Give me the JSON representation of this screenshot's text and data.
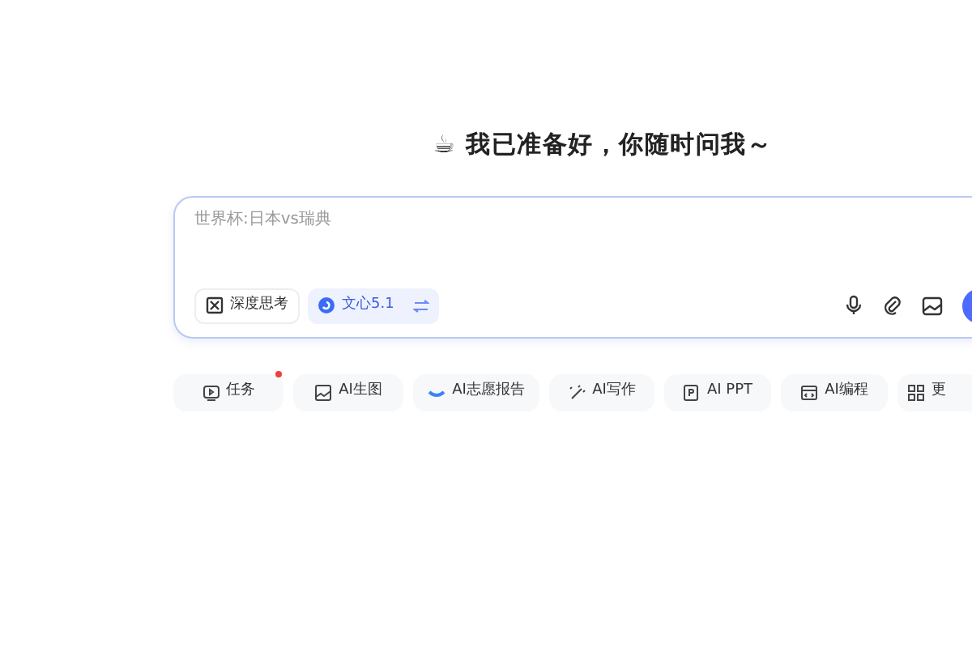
{
  "heading": "☕ 我已准备好，你随时问我～",
  "composer": {
    "placeholder": "世界杯:日本vs瑞典",
    "toggles": [
      {
        "kind": "deep-think",
        "label": "深度思考",
        "selected": false
      },
      {
        "kind": "model",
        "label": "文心5.1",
        "selected": true
      }
    ]
  },
  "chips": [
    {
      "kind": "task",
      "label": "任务",
      "badge": true
    },
    {
      "kind": "image",
      "label": "AI生图",
      "badge": false
    },
    {
      "kind": "report",
      "label": "AI志愿报告",
      "badge": false
    },
    {
      "kind": "write",
      "label": "AI写作",
      "badge": false
    },
    {
      "kind": "ppt",
      "label": "AI PPT",
      "badge": false
    },
    {
      "kind": "code",
      "label": "AI编程",
      "badge": false
    },
    {
      "kind": "more",
      "label": "更",
      "badge": false
    }
  ]
}
